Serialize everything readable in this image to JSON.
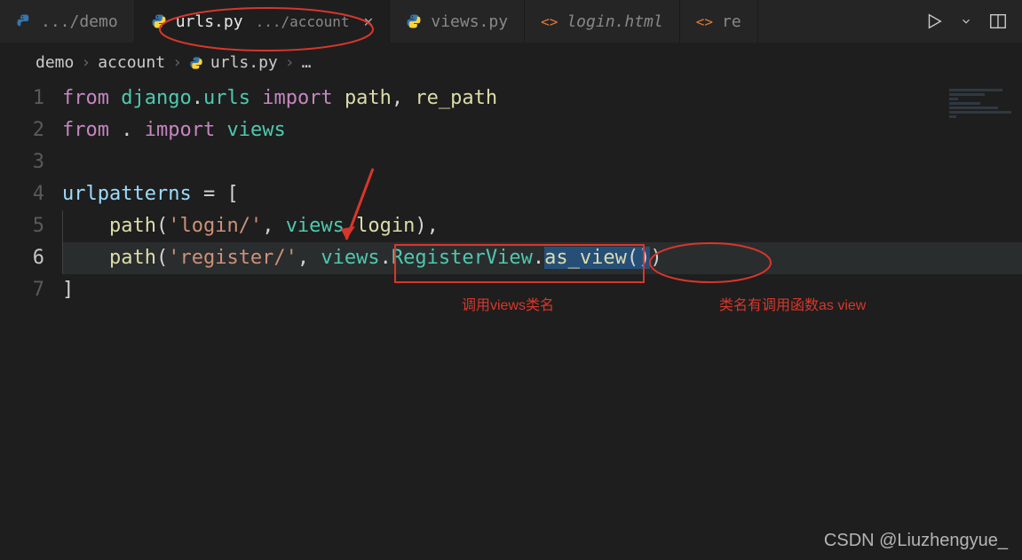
{
  "tabs": [
    {
      "icon": "python",
      "name": ".../demo",
      "file": null
    },
    {
      "icon": "python",
      "name": "urls.py",
      "sub": ".../account",
      "closeable": true,
      "active": true
    },
    {
      "icon": "python",
      "name": "views.py"
    },
    {
      "icon": "html",
      "name": "login.html"
    },
    {
      "icon": "html",
      "name": "re"
    }
  ],
  "breadcrumb": {
    "parts": [
      "demo",
      "account"
    ],
    "file_icon": "python",
    "file": "urls.py",
    "more": "…"
  },
  "code": {
    "lines": [
      {
        "n": 1,
        "seg": [
          [
            "kw",
            "from"
          ],
          [
            "pn",
            " "
          ],
          [
            "mod",
            "django"
          ],
          [
            "pn",
            "."
          ],
          [
            "mod",
            "urls"
          ],
          [
            "pn",
            " "
          ],
          [
            "kw",
            "import"
          ],
          [
            "pn",
            " "
          ],
          [
            "fn",
            "path"
          ],
          [
            "pn",
            ", "
          ],
          [
            "fn",
            "re_path"
          ]
        ]
      },
      {
        "n": 2,
        "seg": [
          [
            "kw",
            "from"
          ],
          [
            "pn",
            " "
          ],
          [
            "pn",
            "."
          ],
          [
            "pn",
            " "
          ],
          [
            "kw",
            "import"
          ],
          [
            "pn",
            " "
          ],
          [
            "mod",
            "views"
          ]
        ]
      },
      {
        "n": 3,
        "seg": [],
        "blank": true
      },
      {
        "n": 4,
        "seg": [
          [
            "var",
            "urlpatterns"
          ],
          [
            "pn",
            " "
          ],
          [
            "op",
            "="
          ],
          [
            "pn",
            " ["
          ]
        ]
      },
      {
        "n": 5,
        "indent": 1,
        "seg": [
          [
            "fn",
            "path"
          ],
          [
            "pn",
            "("
          ],
          [
            "str",
            "'login/'"
          ],
          [
            "pn",
            ", "
          ],
          [
            "mod",
            "views"
          ],
          [
            "pn",
            "."
          ],
          [
            "fn",
            "login"
          ],
          [
            "pn",
            "),"
          ]
        ]
      },
      {
        "n": 6,
        "indent": 1,
        "current": true,
        "seg": [
          [
            "fn",
            "path"
          ],
          [
            "pn",
            "("
          ],
          [
            "str",
            "'register/'"
          ],
          [
            "pn",
            ", "
          ],
          [
            "mod",
            "views"
          ],
          [
            "pn",
            "."
          ],
          [
            "cls",
            "RegisterView"
          ],
          [
            "pn",
            "."
          ],
          [
            "fn_sel",
            "as_view"
          ],
          [
            "pn_sel",
            "("
          ],
          [
            "pn_sel2",
            ")"
          ],
          [
            "pn",
            ")"
          ]
        ]
      },
      {
        "n": 7,
        "seg": [
          [
            "pn",
            "]"
          ]
        ]
      }
    ]
  },
  "annotations": {
    "label1": "调用views类名",
    "label2": "类名有调用函数as view"
  },
  "watermark": "CSDN @Liuzhengyue_"
}
